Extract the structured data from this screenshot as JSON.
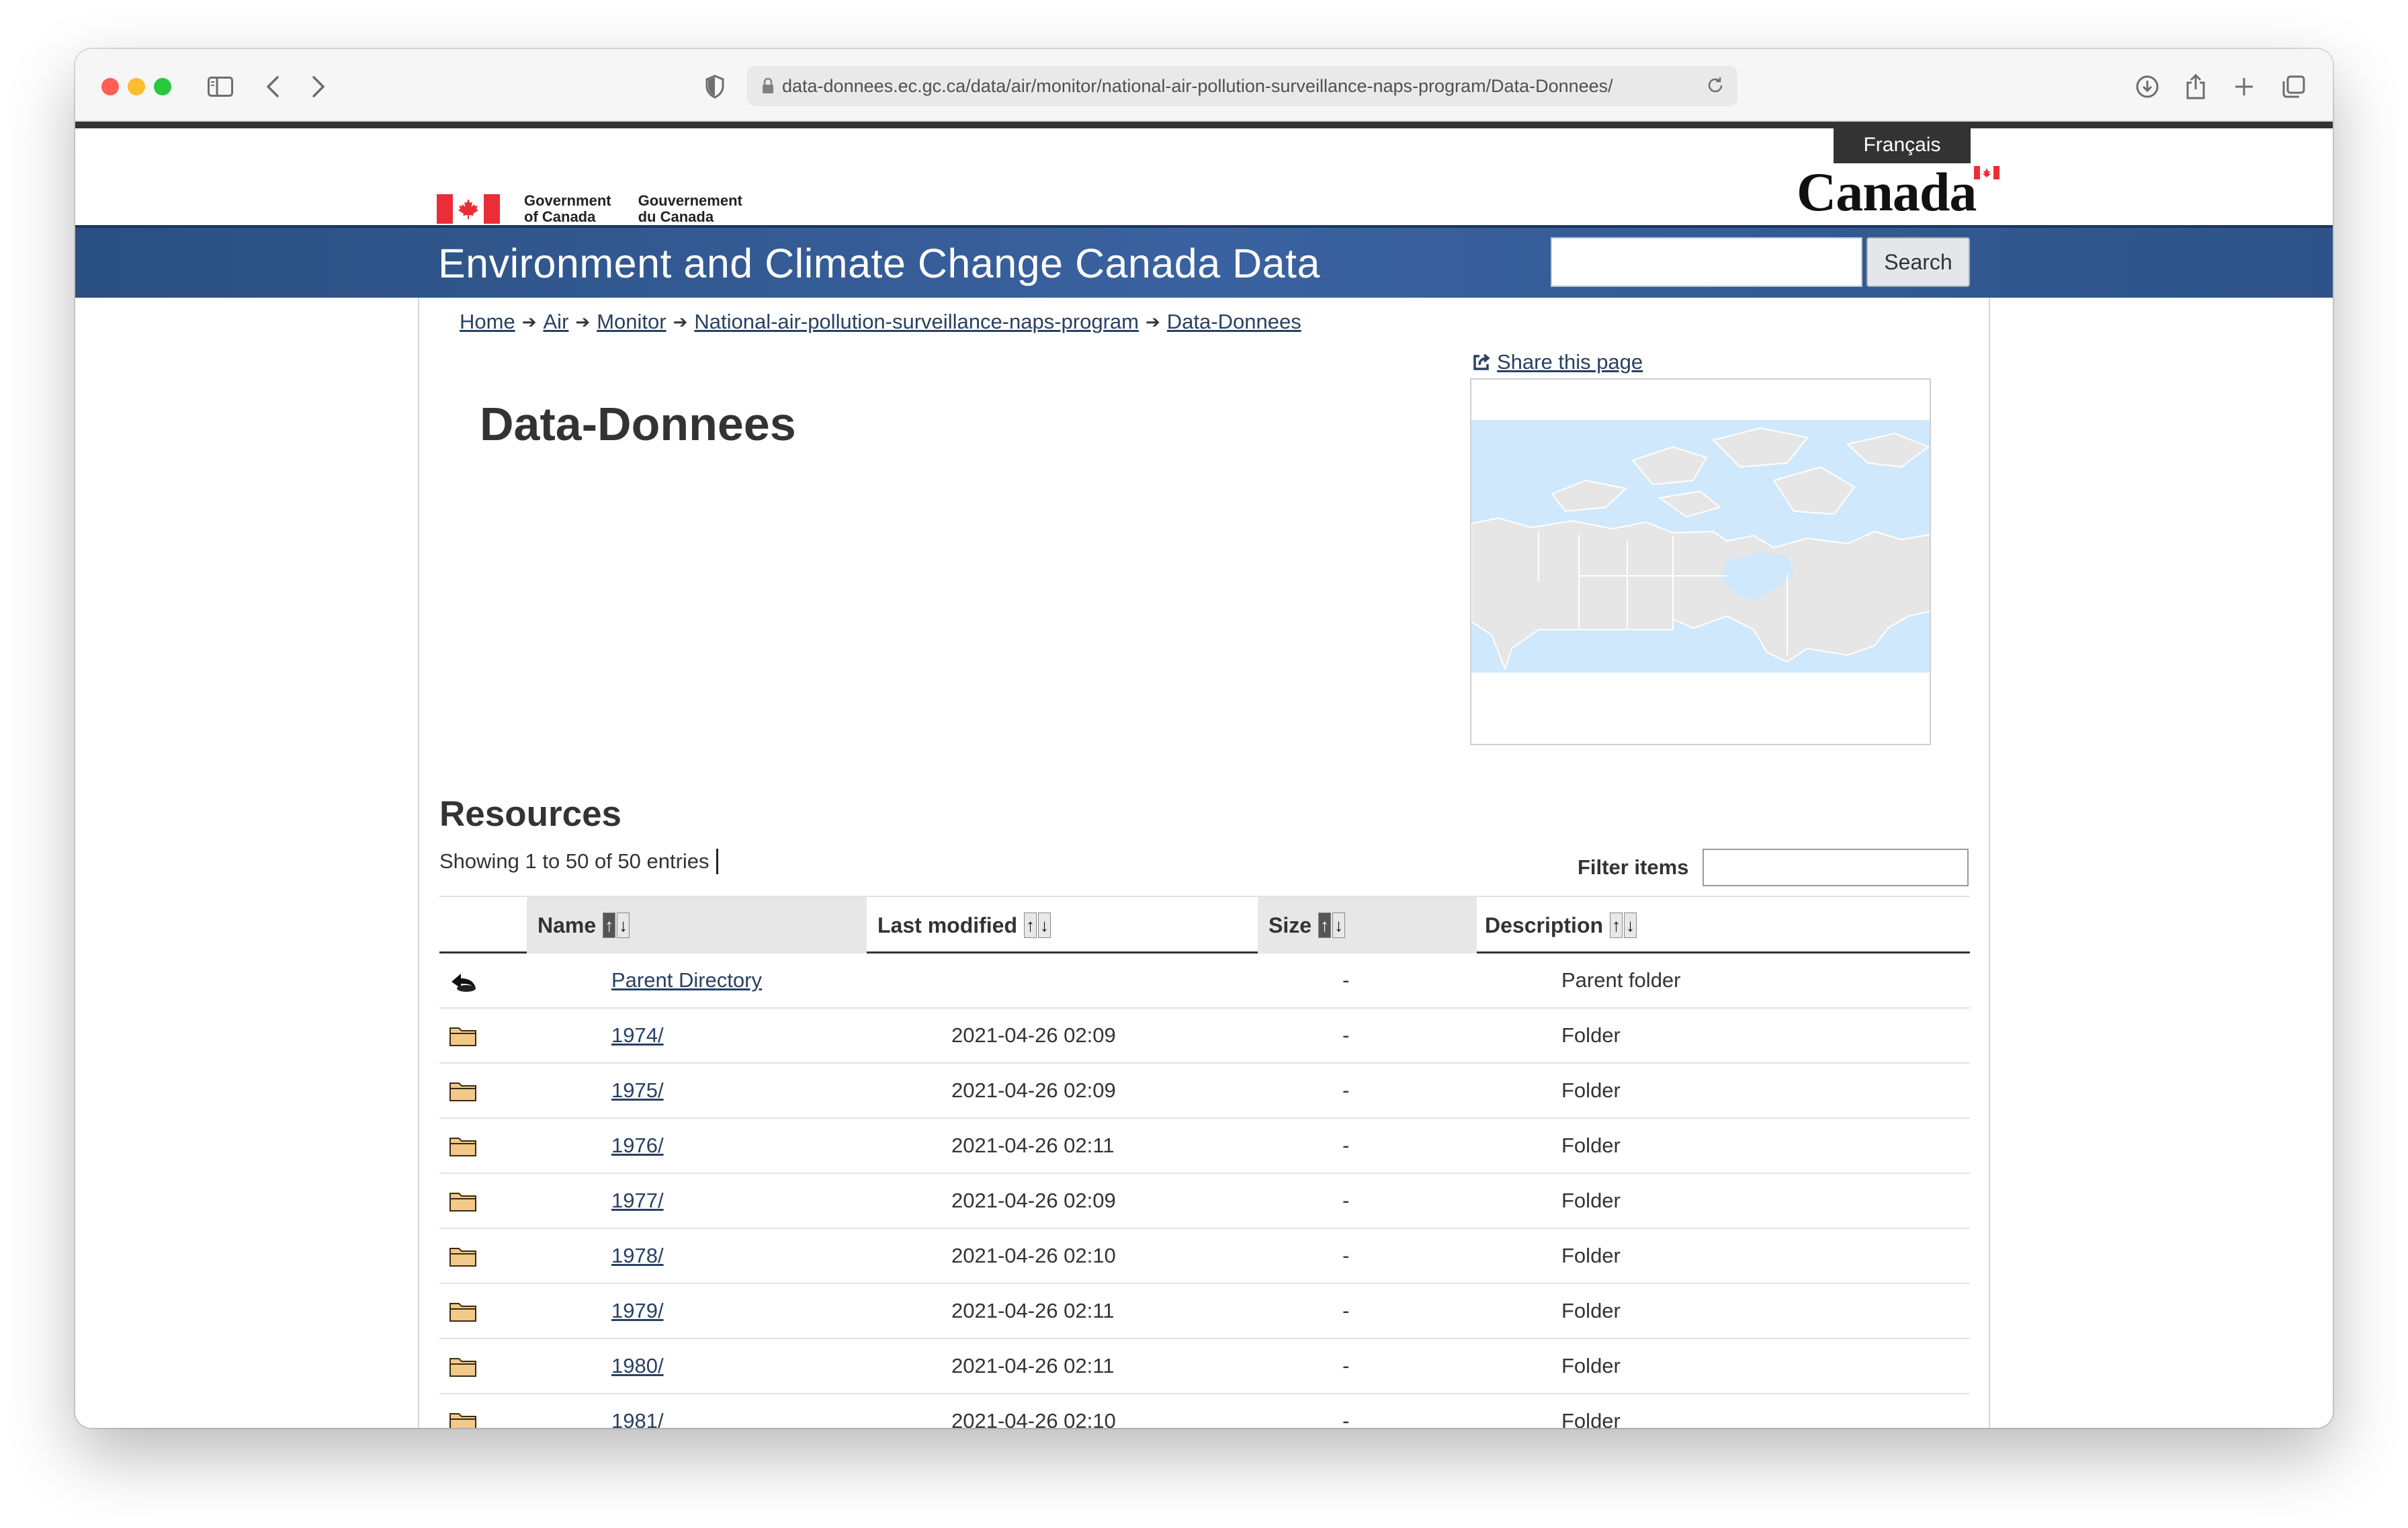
{
  "browser": {
    "url": "data-donnees.ec.gc.ca/data/air/monitor/national-air-pollution-surveillance-naps-program/Data-Donnees/"
  },
  "gc_header": {
    "fip_en_line1": "Government",
    "fip_en_line2": "of Canada",
    "fip_fr_line1": "Gouvernement",
    "fip_fr_line2": "du Canada",
    "language_toggle": "Français",
    "wordmark": "Canada"
  },
  "banner": {
    "title": "Environment and Climate Change Canada Data",
    "search_button": "Search",
    "search_value": ""
  },
  "breadcrumb": [
    {
      "label": "Home"
    },
    {
      "label": "Air"
    },
    {
      "label": "Monitor"
    },
    {
      "label": "National-air-pollution-surveillance-naps-program"
    },
    {
      "label": "Data-Donnees"
    }
  ],
  "share": {
    "label": "Share this page"
  },
  "page_title": "Data-Donnees",
  "resources": {
    "title": "Resources",
    "showing": "Showing 1 to 50 of 50 entries",
    "filter_label": "Filter items",
    "filter_value": ""
  },
  "table": {
    "headers": {
      "name": "Name",
      "last_modified": "Last modified",
      "size": "Size",
      "description": "Description"
    },
    "rows": [
      {
        "icon": "back-arrow-icon",
        "name": "Parent Directory",
        "modified": "",
        "size": "-",
        "description": "Parent folder"
      },
      {
        "icon": "folder-icon",
        "name": "1974/",
        "modified": "2021-04-26 02:09",
        "size": "-",
        "description": "Folder"
      },
      {
        "icon": "folder-icon",
        "name": "1975/",
        "modified": "2021-04-26 02:09",
        "size": "-",
        "description": "Folder"
      },
      {
        "icon": "folder-icon",
        "name": "1976/",
        "modified": "2021-04-26 02:11",
        "size": "-",
        "description": "Folder"
      },
      {
        "icon": "folder-icon",
        "name": "1977/",
        "modified": "2021-04-26 02:09",
        "size": "-",
        "description": "Folder"
      },
      {
        "icon": "folder-icon",
        "name": "1978/",
        "modified": "2021-04-26 02:10",
        "size": "-",
        "description": "Folder"
      },
      {
        "icon": "folder-icon",
        "name": "1979/",
        "modified": "2021-04-26 02:11",
        "size": "-",
        "description": "Folder"
      },
      {
        "icon": "folder-icon",
        "name": "1980/",
        "modified": "2021-04-26 02:11",
        "size": "-",
        "description": "Folder"
      },
      {
        "icon": "folder-icon",
        "name": "1981/",
        "modified": "2021-04-26 02:10",
        "size": "-",
        "description": "Folder"
      }
    ]
  },
  "colors": {
    "banner": "#2a4f81",
    "link": "#284162",
    "flag_red": "#eb2d37",
    "map_water": "#cfe8fb",
    "map_land": "#e6e6e6"
  }
}
